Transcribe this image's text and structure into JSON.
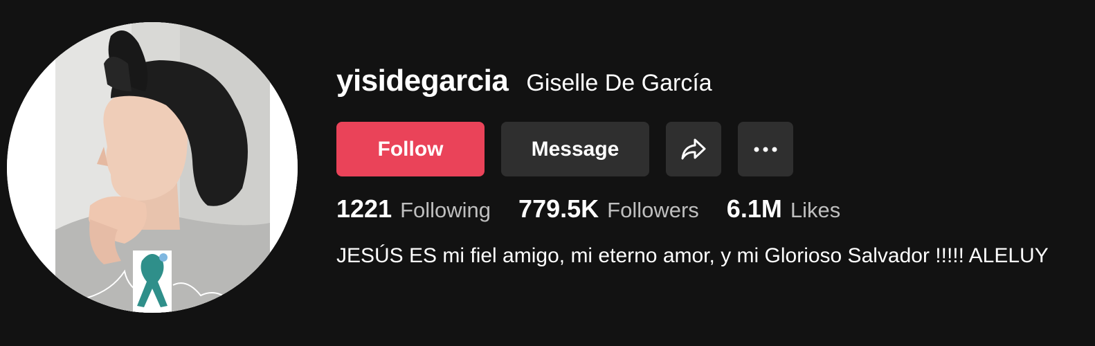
{
  "profile": {
    "username": "yisidegarcia",
    "display_name": "Giselle De García",
    "bio": "JESÚS ES mi fiel amigo, mi eterno amor, y mi Glorioso Salvador !!!!! ALELUY"
  },
  "actions": {
    "follow_label": "Follow",
    "message_label": "Message",
    "share_icon": "share-arrow-icon",
    "more_icon": "more-dots-icon"
  },
  "stats": {
    "following_value": "1221",
    "following_label": "Following",
    "followers_value": "779.5K",
    "followers_label": "Followers",
    "likes_value": "6.1M",
    "likes_label": "Likes"
  },
  "colors": {
    "background": "#121212",
    "follow_button": "#ea4359",
    "secondary_button": "#2f2f2f",
    "stat_label": "#bfbfbf"
  }
}
